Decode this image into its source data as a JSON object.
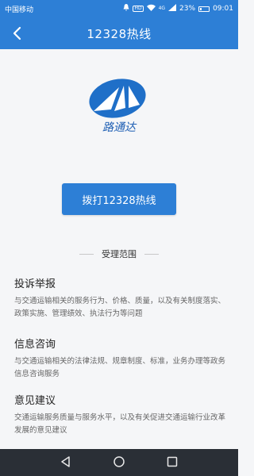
{
  "status_bar": {
    "carrier": "中国移动",
    "signal": "4G",
    "hd": "HD",
    "battery_percent": "23%",
    "battery_level": 0.23,
    "time": "09:01"
  },
  "header": {
    "title": "12328热线"
  },
  "logo": {
    "text": "路通达"
  },
  "dial_button": {
    "label": "拨打12328热线"
  },
  "scope": {
    "title": "受理范围",
    "items": [
      {
        "title": "投诉举报",
        "description": "与交通运输相关的服务行为、价格、质量，以及有关制度落实、政策实施、管理绩效、执法行为等问题"
      },
      {
        "title": "信息咨询",
        "description": "与交通运输相关的法律法规、规章制度、标准，业务办理等政务信息咨询服务"
      },
      {
        "title": "意见建议",
        "description": "交通运输服务质量与服务水平，以及有关促进交通运输行业改革发展的意见建议"
      }
    ]
  },
  "colors": {
    "primary": "#2d7fd6",
    "nav_bar": "#2a2f36"
  }
}
